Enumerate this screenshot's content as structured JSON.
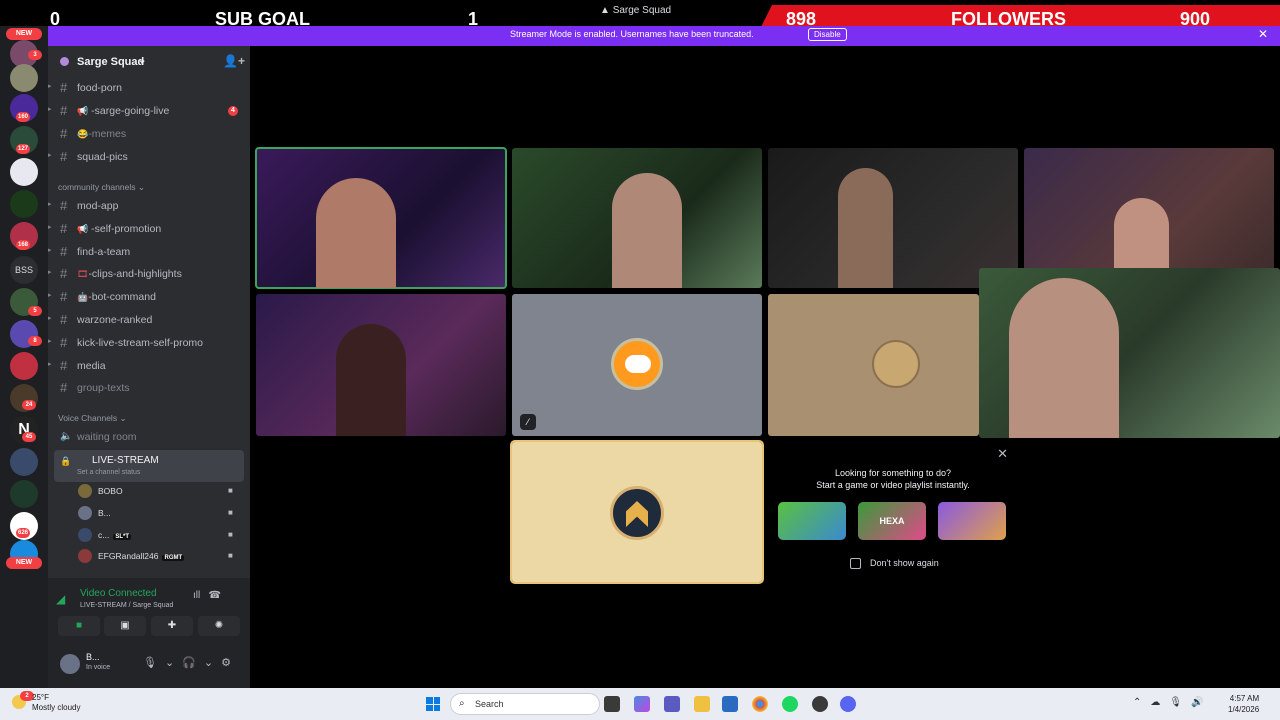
{
  "overlay": {
    "sub_goal": {
      "current": "0",
      "label": "SUB GOAL",
      "target": "1"
    },
    "followers": {
      "current": "898",
      "label": "FOLLOWERS",
      "target": "900"
    },
    "window_title": "Sarge Squad"
  },
  "streamer_mode": {
    "message": "Streamer Mode is enabled. Usernames have been truncated.",
    "disable_label": "Disable",
    "close_icon": "close-icon"
  },
  "rail": {
    "new_top": "NEW",
    "new_bottom": "NEW",
    "badges": [
      "3",
      "160",
      "127",
      "168",
      "5",
      "8",
      "24",
      "45",
      "626"
    ],
    "bss_label": "BSS"
  },
  "server": {
    "name": "Sarge Squad",
    "channels": [
      {
        "label": "food-porn"
      },
      {
        "label": "-sarge-going-live",
        "emoji": "📢",
        "count": "4"
      },
      {
        "label": "-memes",
        "emoji": "😂"
      },
      {
        "label": "squad-pics"
      }
    ],
    "community_category": "community channels",
    "community_channels": [
      {
        "label": "mod-app"
      },
      {
        "label": "-self-promotion",
        "emoji": "📢"
      },
      {
        "label": "find-a-team"
      },
      {
        "label": "-clips-and-highlights",
        "emoji": "🎞"
      },
      {
        "label": "-bot-command",
        "emoji": "🤖"
      },
      {
        "label": "warzone-ranked"
      },
      {
        "label": "kick-live-stream-self-promo"
      },
      {
        "label": "media"
      },
      {
        "label": "group-texts"
      }
    ],
    "voice_category": "Voice Channels",
    "voice_waiting": "waiting room",
    "voice_live": {
      "name": "LIVE-STREAM",
      "status": "Set a channel status"
    },
    "members": [
      {
        "name": "BOBO"
      },
      {
        "name": "B..."
      },
      {
        "name": "c...",
        "tag": "SL*T"
      },
      {
        "name": "EFGRandall246",
        "tag": "RGMT"
      }
    ]
  },
  "voice_panel": {
    "status": "Video Connected",
    "location": "LIVE-STREAM / Sarge Squad"
  },
  "user": {
    "name": "B...",
    "status": "In voice"
  },
  "promo": {
    "line1": "Looking for something to do?",
    "line2": "Start a game or video playlist instantly.",
    "games": [
      "",
      "HEXA",
      ""
    ],
    "dont_show": "Don't show again"
  },
  "taskbar": {
    "temp": "25°F",
    "weather": "Mostly cloudy",
    "weather_badge": "2",
    "search": "Search",
    "time": "4:57 AM",
    "date": "1/4/2026"
  },
  "colors": {
    "accent": "#7b2ff2",
    "follower_red": "#e0121d",
    "speaking": "#3ba55c"
  }
}
